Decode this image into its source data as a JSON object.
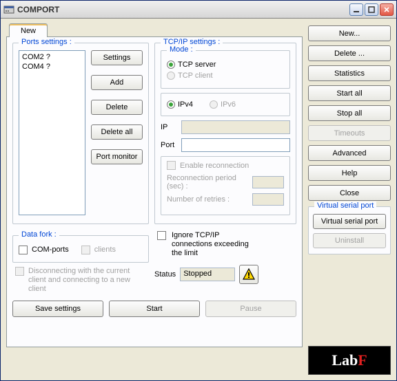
{
  "window": {
    "title": "COMPORT"
  },
  "tabs": {
    "new": "New"
  },
  "ports": {
    "legend": "Ports settings :",
    "items": [
      "COM2 ?",
      "COM4 ?"
    ],
    "buttons": {
      "settings": "Settings",
      "add": "Add",
      "delete": "Delete",
      "delete_all": "Delete all",
      "port_monitor": "Port monitor"
    }
  },
  "tcp": {
    "legend": "TCP/IP settings :",
    "mode": {
      "legend": "Mode :",
      "server": "TCP server",
      "client": "TCP client"
    },
    "ipver": {
      "v4": "IPv4",
      "v6": "IPv6"
    },
    "ip_label": "IP",
    "ip_value": "",
    "port_label": "Port",
    "port_value": "",
    "reconnect": {
      "enable": "Enable reconnection",
      "period_label": "Reconnection period (sec) :",
      "period_value": "",
      "retries_label": "Number of retries :",
      "retries_value": ""
    }
  },
  "datafork": {
    "legend": "Data fork :",
    "comports": "COM-ports",
    "clients": "clients"
  },
  "ignore_label": "Ignore TCP/IP connections exceeding the limit",
  "disconnect_note": "Disconnecting with the current client and connecting to a new client",
  "status": {
    "label": "Status",
    "value": "Stopped"
  },
  "bottom": {
    "save": "Save settings",
    "start": "Start",
    "pause": "Pause"
  },
  "right": {
    "new": "New...",
    "delete": "Delete ...",
    "statistics": "Statistics",
    "start_all": "Start all",
    "stop_all": "Stop all",
    "timeouts": "Timeouts",
    "advanced": "Advanced",
    "help": "Help",
    "close": "Close"
  },
  "vsp": {
    "legend": "Virtual serial port",
    "button": "Virtual serial port",
    "uninstall": "Uninstall"
  },
  "logo": {
    "text": "Lab",
    "accent": "F"
  }
}
